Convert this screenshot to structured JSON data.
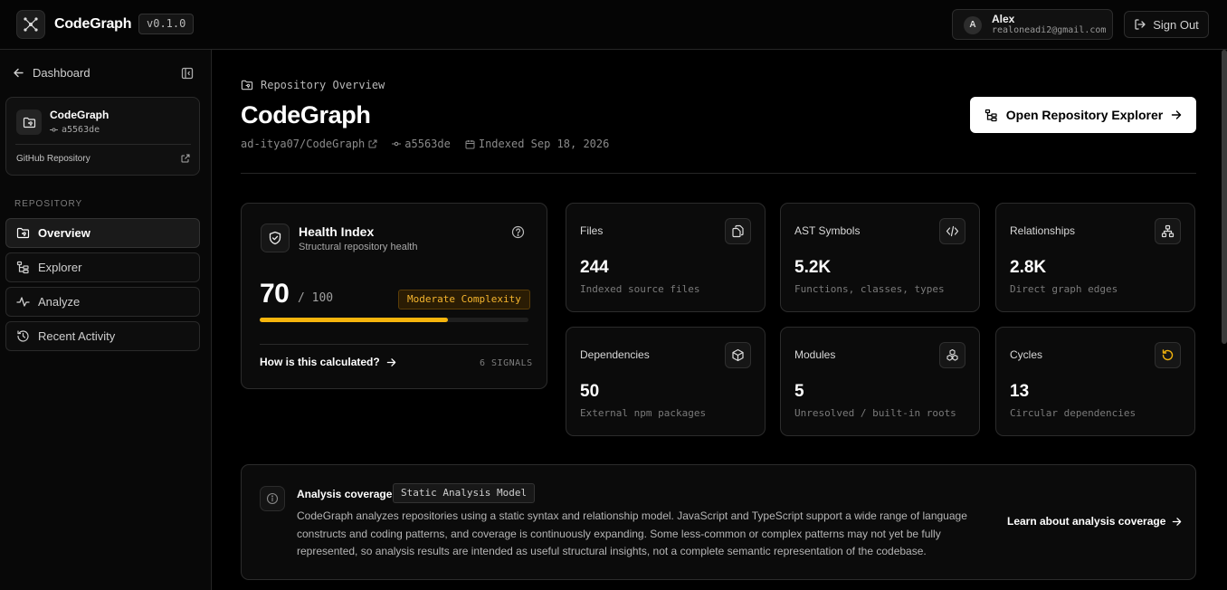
{
  "topbar": {
    "brand": "CodeGraph",
    "version": "v0.1.0",
    "user": {
      "initial": "A",
      "name": "Alex",
      "email": "realoneadi2@gmail.com"
    },
    "signout_label": "Sign Out"
  },
  "sidebar": {
    "back_label": "Dashboard",
    "repo": {
      "name": "CodeGraph",
      "commit": "a5563de",
      "link_label": "GitHub Repository"
    },
    "section_label": "REPOSITORY",
    "items": [
      {
        "label": "Overview",
        "icon": "folder-git-icon",
        "active": true
      },
      {
        "label": "Explorer",
        "icon": "tree-icon",
        "active": false
      },
      {
        "label": "Analyze",
        "icon": "activity-icon",
        "active": false
      },
      {
        "label": "Recent Activity",
        "icon": "history-icon",
        "active": false
      }
    ]
  },
  "header": {
    "crumb": "Repository Overview",
    "title": "CodeGraph",
    "repo_path": "ad-itya07/CodeGraph",
    "commit": "a5563de",
    "indexed": "Indexed Sep 18, 2026",
    "open_button": "Open Repository Explorer"
  },
  "health": {
    "title": "Health Index",
    "subtitle": "Structural repository health",
    "score": "70",
    "max": "/ 100",
    "score_fraction": 0.7,
    "badge": "Moderate Complexity",
    "how_label": "How is this calculated?",
    "signals": "6 SIGNALS",
    "accent": "#f5b50d"
  },
  "stats": [
    {
      "label": "Files",
      "value": "244",
      "sub": "Indexed source files",
      "icon": "files-icon"
    },
    {
      "label": "AST Symbols",
      "value": "5.2K",
      "sub": "Functions, classes, types",
      "icon": "code-icon"
    },
    {
      "label": "Relationships",
      "value": "2.8K",
      "sub": "Direct graph edges",
      "icon": "network-icon"
    },
    {
      "label": "Dependencies",
      "value": "50",
      "sub": "External npm packages",
      "icon": "package-icon"
    },
    {
      "label": "Modules",
      "value": "5",
      "sub": "Unresolved / built-in roots",
      "icon": "boxes-icon"
    },
    {
      "label": "Cycles",
      "value": "13",
      "sub": "Circular dependencies",
      "icon": "refresh-icon"
    }
  ],
  "coverage": {
    "title": "Analysis coverage",
    "badge": "Static Analysis Model",
    "text": "CodeGraph analyzes repositories using a static syntax and relationship model. JavaScript and TypeScript support a wide range of language constructs and coding patterns, and coverage is continuously expanding. Some less-common or complex patterns may not yet be fully represented, so analysis results are intended as useful structural insights, not a complete semantic representation of the codebase.",
    "link": "Learn about analysis coverage"
  }
}
